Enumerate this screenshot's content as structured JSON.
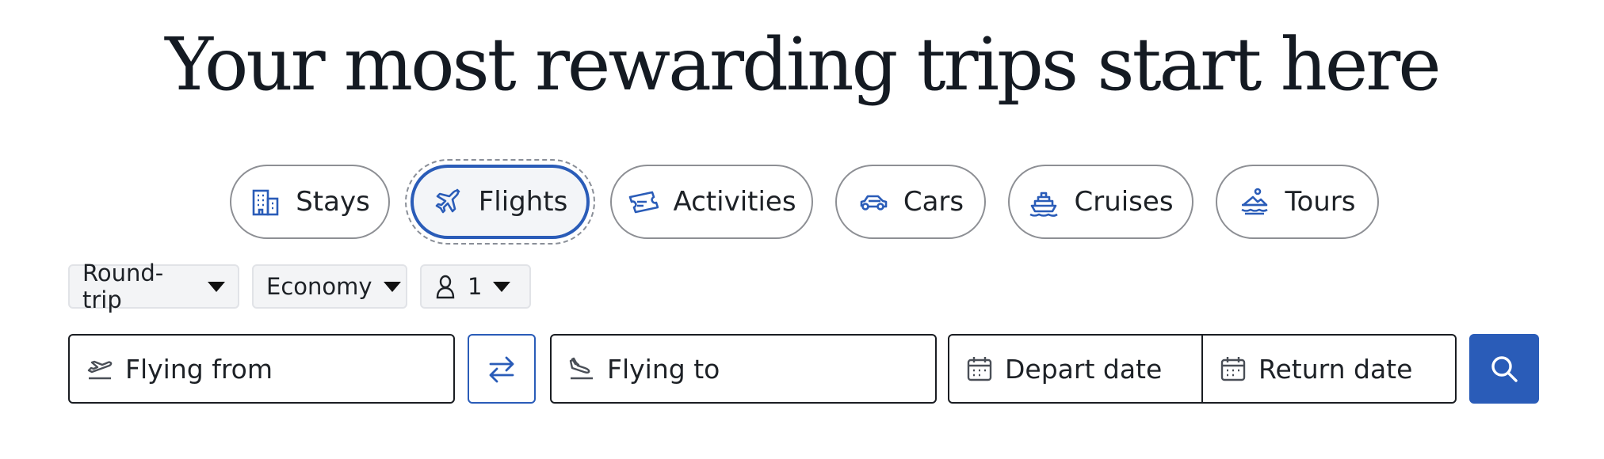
{
  "headline": "Your most rewarding trips start here",
  "tabs": [
    {
      "label": "Stays",
      "icon": "hotel-building-icon"
    },
    {
      "label": "Flights",
      "icon": "airplane-icon"
    },
    {
      "label": "Activities",
      "icon": "ticket-icon"
    },
    {
      "label": "Cars",
      "icon": "car-icon"
    },
    {
      "label": "Cruises",
      "icon": "cruise-ship-icon"
    },
    {
      "label": "Tours",
      "icon": "tour-boat-icon"
    }
  ],
  "active_tab": "Flights",
  "options": {
    "trip_type": "Round-trip",
    "cabin_class": "Economy",
    "travelers": "1"
  },
  "search": {
    "from_placeholder": "Flying from",
    "to_placeholder": "Flying to",
    "depart_placeholder": "Depart date",
    "return_placeholder": "Return date"
  },
  "colors": {
    "accent": "#2a5cb8",
    "text": "#141a22",
    "border": "#8d8f94",
    "chip_bg": "#f3f4f6"
  }
}
